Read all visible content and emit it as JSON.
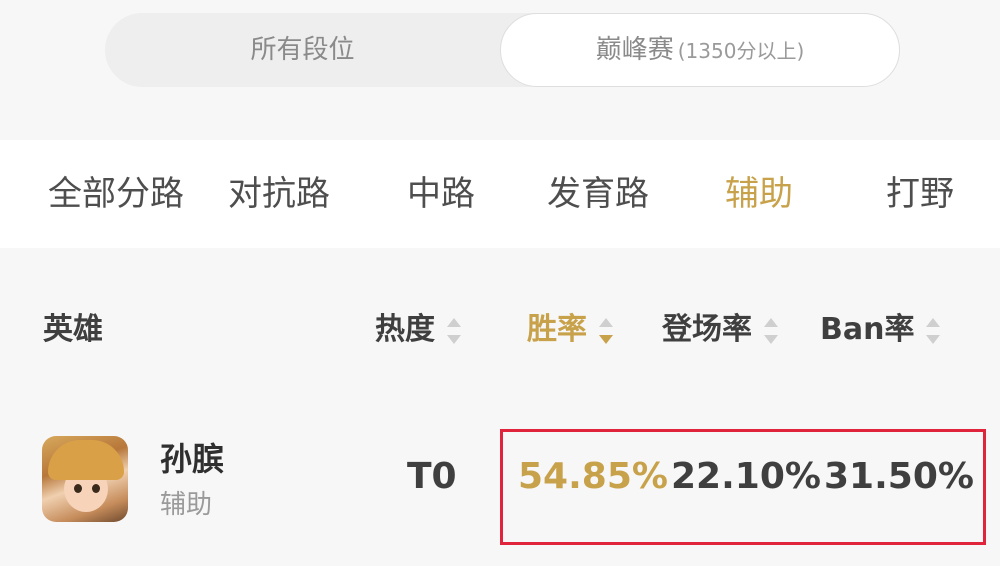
{
  "rank_filter": {
    "all_ranks": "所有段位",
    "peak": "巅峰赛",
    "peak_sub": "(1350分以上)"
  },
  "lanes": [
    "全部分路",
    "对抗路",
    "中路",
    "发育路",
    "辅助",
    "打野"
  ],
  "active_lane": "辅助",
  "columns": {
    "hero": "英雄",
    "heat": "热度",
    "win_rate": "胜率",
    "pick_rate": "登场率",
    "ban_rate": "Ban率"
  },
  "rows": [
    {
      "name": "孙膑",
      "role": "辅助",
      "tier": "T0",
      "win_rate": "54.85%",
      "pick_rate": "22.10%",
      "ban_rate": "31.50%"
    }
  ],
  "colors": {
    "accent": "#c8a24a",
    "highlight_border": "#e0243c"
  },
  "icons": {
    "sort": "sort-arrows-icon",
    "avatar": "hero-portrait"
  }
}
